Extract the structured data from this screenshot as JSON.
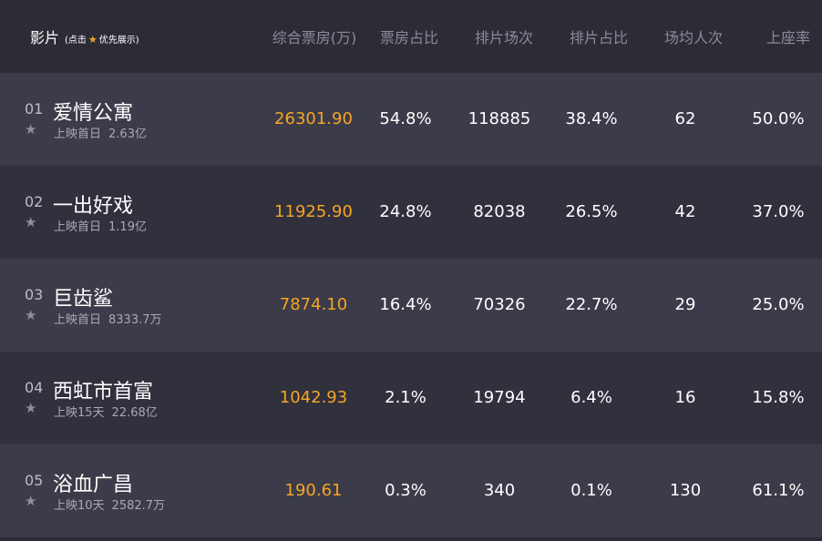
{
  "header": {
    "film_label": "影片",
    "hint_prefix": "(点击",
    "hint_suffix": "优先展示)",
    "hint_star": "★",
    "columns": [
      "综合票房(万)",
      "票房占比",
      "排片场次",
      "排片占比",
      "场均人次",
      "上座率"
    ]
  },
  "star_glyph": "★",
  "colors": {
    "accent": "#f5a623",
    "row_odd": "#3c3b49",
    "row_even": "#31303d",
    "header_bg": "#2c2c37"
  },
  "rows": [
    {
      "rank": "01",
      "name": "爱情公寓",
      "release": "上映首日",
      "total": "2.63亿",
      "box_office": "26301.90",
      "box_share": "54.8%",
      "screenings": "118885",
      "screen_share": "38.4%",
      "avg_people": "62",
      "occupancy": "50.0%"
    },
    {
      "rank": "02",
      "name": "一出好戏",
      "release": "上映首日",
      "total": "1.19亿",
      "box_office": "11925.90",
      "box_share": "24.8%",
      "screenings": "82038",
      "screen_share": "26.5%",
      "avg_people": "42",
      "occupancy": "37.0%"
    },
    {
      "rank": "03",
      "name": "巨齿鲨",
      "release": "上映首日",
      "total": "8333.7万",
      "box_office": "7874.10",
      "box_share": "16.4%",
      "screenings": "70326",
      "screen_share": "22.7%",
      "avg_people": "29",
      "occupancy": "25.0%"
    },
    {
      "rank": "04",
      "name": "西虹市首富",
      "release": "上映15天",
      "total": "22.68亿",
      "box_office": "1042.93",
      "box_share": "2.1%",
      "screenings": "19794",
      "screen_share": "6.4%",
      "avg_people": "16",
      "occupancy": "15.8%"
    },
    {
      "rank": "05",
      "name": "浴血广昌",
      "release": "上映10天",
      "total": "2582.7万",
      "box_office": "190.61",
      "box_share": "0.3%",
      "screenings": "340",
      "screen_share": "0.1%",
      "avg_people": "130",
      "occupancy": "61.1%"
    }
  ]
}
